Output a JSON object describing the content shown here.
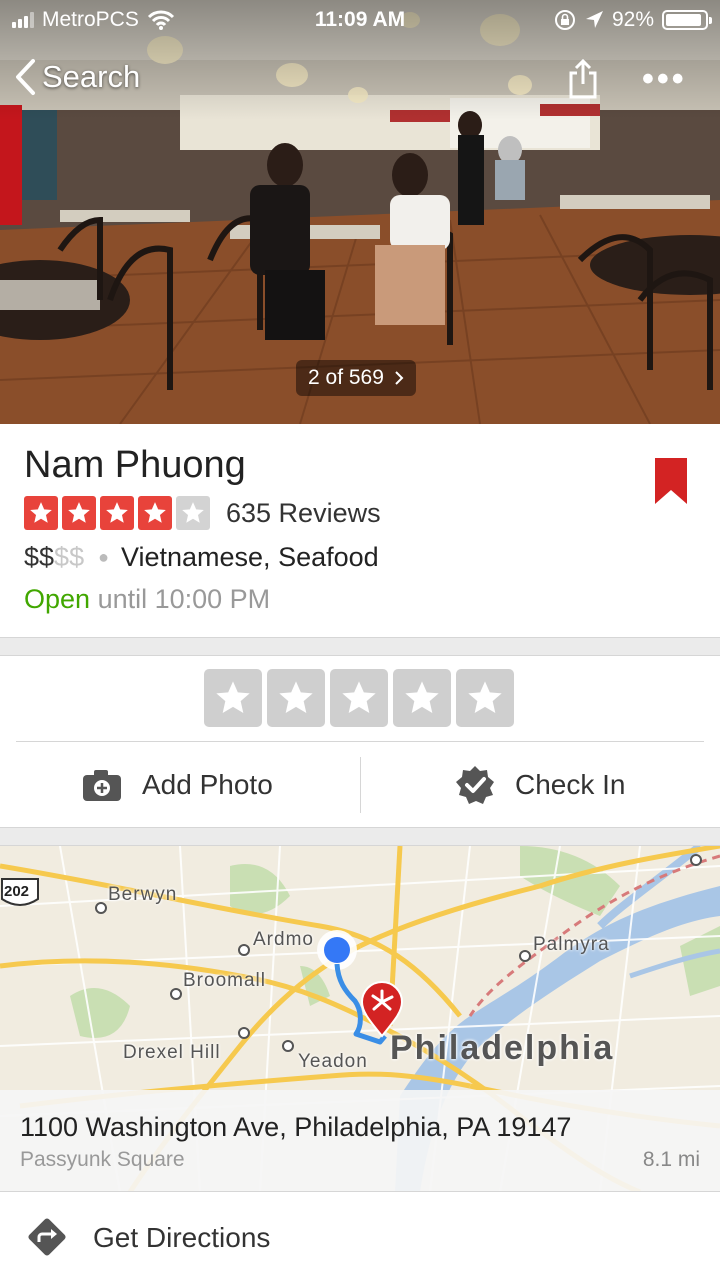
{
  "status_bar": {
    "carrier": "MetroPCS",
    "time": "11:09 AM",
    "battery_percent": "92%",
    "battery_level": 0.92
  },
  "nav": {
    "back_label": "Search"
  },
  "photo": {
    "counter": "2 of 569"
  },
  "business": {
    "name": "Nam Phuong",
    "rating": 4,
    "rating_max": 5,
    "reviews": "635 Reviews",
    "price_active": "$$",
    "price_inactive": "$$",
    "categories": "Vietnamese, Seafood",
    "open_status": "Open",
    "hours": "until 10:00 PM",
    "bookmarked": true
  },
  "actions": {
    "add_photo": "Add Photo",
    "check_in": "Check In"
  },
  "map": {
    "labels": {
      "berwyn": "Berwyn",
      "ardmore": "Ardmo",
      "palmyra": "Palmyra",
      "broomall": "Broomall",
      "drexel_hill": "Drexel Hill",
      "yeadon": "Yeadon",
      "philadelphia": "Philadelphia",
      "route": "202"
    },
    "address": "1100 Washington Ave, Philadelphia, PA 19147",
    "neighborhood": "Passyunk Square",
    "distance": "8.1 mi"
  },
  "directions": {
    "label": "Get Directions"
  },
  "colors": {
    "star_red": "#e8433b",
    "star_empty": "#d3d3d3",
    "open_green": "#41a700",
    "bookmark_red": "#d32323",
    "pin_red": "#d32323",
    "user_blue": "#3478f6",
    "route_blue": "#3a8ee6"
  }
}
